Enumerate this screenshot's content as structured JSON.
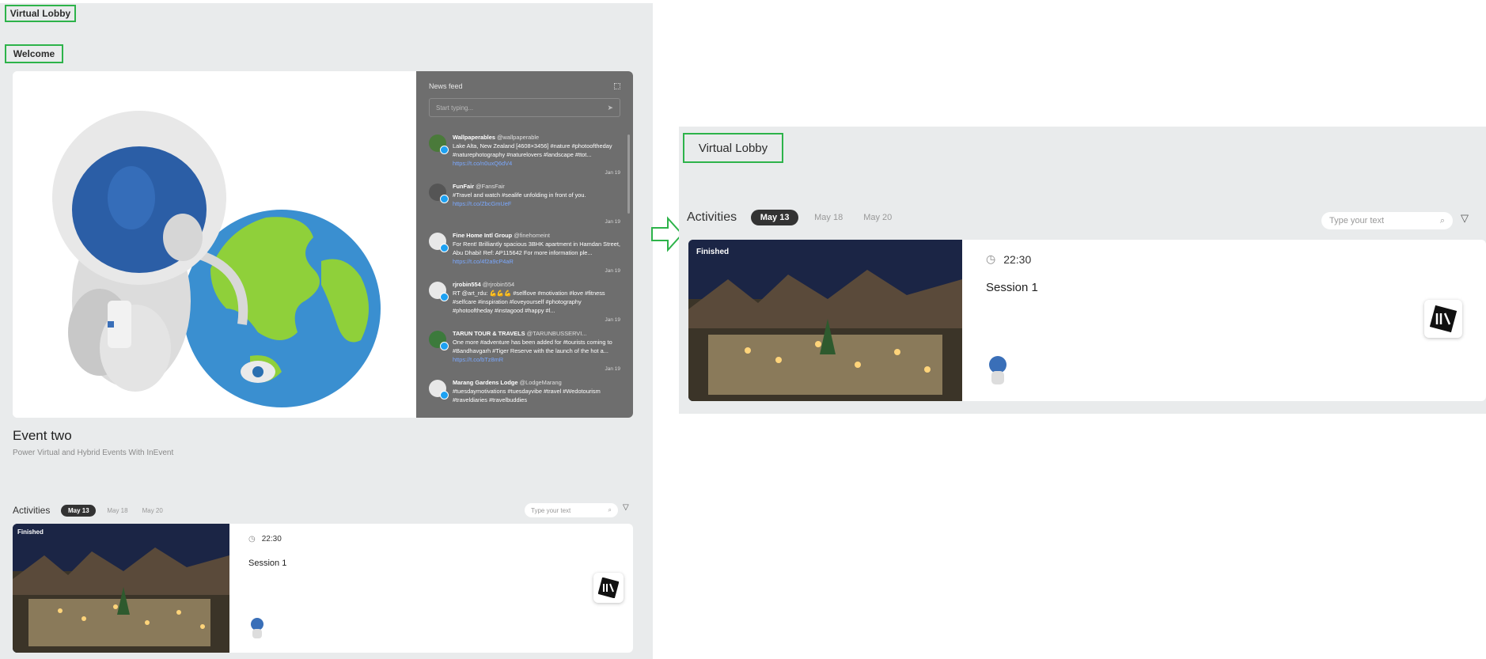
{
  "left_panel": {
    "virtual_lobby_label": "Virtual Lobby",
    "welcome_label": "Welcome",
    "news_feed": {
      "title": "News feed",
      "input_placeholder": "Start typing...",
      "tweets": [
        {
          "name": "Wallpaperables",
          "handle": "@wallpaperable",
          "text": "Lake Alta, New Zealand [4608×3456] #nature #photooftheday #naturephotography #naturelovers #landscape #ttot...",
          "link": "https://t.co/n0uxQ6dV4",
          "date": "Jan 19"
        },
        {
          "name": "FunFair",
          "handle": "@FansFair",
          "text": "#Travel and watch #sealife unfolding in front of you.",
          "link": "https://t.co/ZbcGmUeF",
          "date": "Jan 19"
        },
        {
          "name": "Fine Home Intl Group",
          "handle": "@finehomeint",
          "text": "For Rent! Brilliantly spacious 3BHK apartment in Hamdan Street, Abu Dhabi! Ref: AP115642 For more information ple...",
          "link": "https://t.co/4f2a9cP4aR",
          "date": "Jan 19"
        },
        {
          "name": "rjrobin554",
          "handle": "@rjrobin554",
          "text": "RT @art_rdu: 💪💪💪 #selflove #motivation #love #fitness #selfcare #inspiration #loveyourself #photography #photooftheday #instagood #happy #l...",
          "link": "",
          "date": "Jan 19"
        },
        {
          "name": "TARUN TOUR & TRAVELS",
          "handle": "@TARUNBUSSERVI...",
          "text": "One more #adventure has been added for #tourists coming to #Bandhavgarh #Tiger Reserve with the launch of the hot a...",
          "link": "https://t.co/bTz8mR",
          "date": "Jan 19"
        },
        {
          "name": "Marang Gardens Lodge",
          "handle": "@LodgeMarang",
          "text": "#tuesdaymotivations #tuesdayvibe #travel #Wedotourism #traveldiaries #travelbuddies",
          "link": "",
          "date": ""
        }
      ]
    },
    "event_title": "Event two",
    "event_subtitle": "Power Virtual and Hybrid Events With InEvent"
  },
  "activities": {
    "label": "Activities",
    "dates": [
      "May 13",
      "May 18",
      "May 20"
    ],
    "selected_date": "May 13",
    "search_placeholder": "Type your text",
    "session": {
      "status": "Finished",
      "time": "22:30",
      "title": "Session 1"
    }
  },
  "right_panel": {
    "virtual_lobby_label": "Virtual Lobby"
  },
  "colors": {
    "annotation_green": "#2db34a",
    "panel_bg": "#e9ebec",
    "feed_bg": "#6e6e6e",
    "pill_bg": "#333333"
  }
}
